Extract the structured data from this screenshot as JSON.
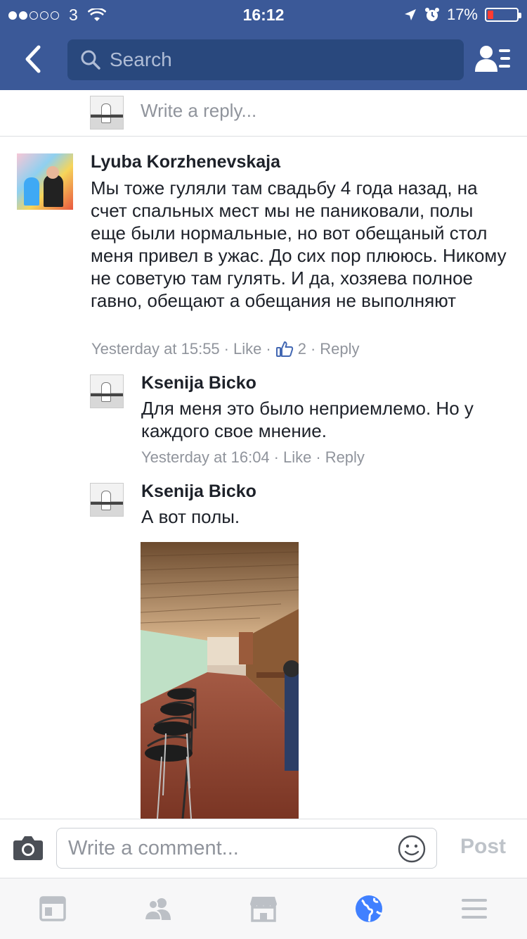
{
  "status_bar": {
    "carrier": "3",
    "time": "16:12",
    "battery": "17%",
    "signal_dots_on": 2,
    "signal_dots_total": 5
  },
  "nav": {
    "search_placeholder": "Search"
  },
  "reply_box": {
    "placeholder": "Write a reply..."
  },
  "comments": [
    {
      "author": "Lyuba Korzhenevskaja",
      "text": "Мы тоже гуляли там свадьбу 4 года назад, на счет спальных мест мы не паниковали, полы еще были нормальные, но вот обещаный стол меня привел в ужас. До сих пор плююсь. Никому не советую там гулять. И да, хозяева полное гавно, обещают а обещания не выполняют",
      "time": "Yesterday at 15:55",
      "like_label": "Like",
      "like_count": "2",
      "reply_label": "Reply"
    },
    {
      "author": "Ksenija Bicko",
      "text": "Для меня это было неприемлемо. Но у каждого свое мнение.",
      "time": "Yesterday at 16:04",
      "like_label": "Like",
      "reply_label": "Reply"
    },
    {
      "author": "Ksenija Bicko",
      "text": "А вот полы."
    }
  ],
  "composer": {
    "placeholder": "Write a comment...",
    "post_label": "Post"
  },
  "tabs": [
    {
      "icon": "news-feed-icon"
    },
    {
      "icon": "friends-icon"
    },
    {
      "icon": "marketplace-icon"
    },
    {
      "icon": "globe-icon",
      "active": true
    },
    {
      "icon": "menu-icon"
    }
  ],
  "colors": {
    "header": "#3b5998",
    "search_bg": "#29487d",
    "active_tab": "#4080ff",
    "inactive_tab": "#bcc0c6"
  }
}
